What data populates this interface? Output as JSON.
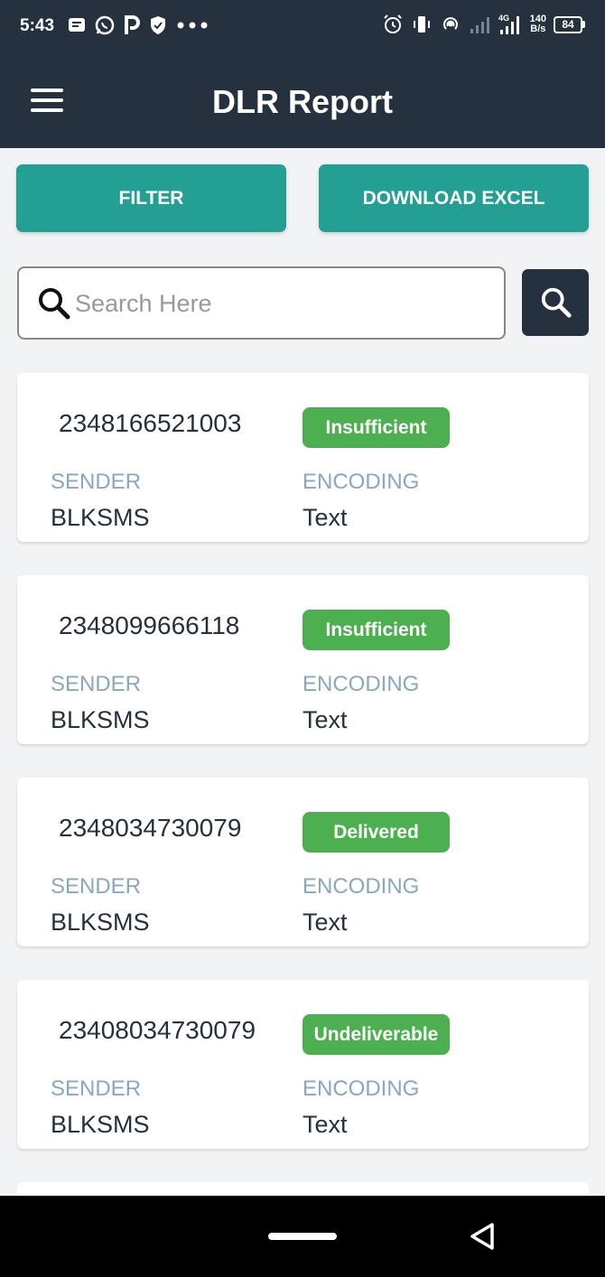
{
  "status_bar": {
    "time": "5:43",
    "net_speed_value": "140",
    "net_speed_unit": "B/s",
    "network_type": "4G",
    "battery": "84",
    "left_icons": [
      "message-icon",
      "whatsapp-icon",
      "p-app-icon",
      "shield-icon",
      "more-dots-icon"
    ],
    "right_icons": [
      "alarm-icon",
      "vibrate-icon",
      "hotspot-icon",
      "signal-icon",
      "signal-4g-icon"
    ]
  },
  "header": {
    "title": "DLR Report"
  },
  "actions": {
    "filter_label": "FILTER",
    "download_label": "DOWNLOAD EXCEL"
  },
  "search": {
    "placeholder": "Search Here",
    "value": ""
  },
  "colors": {
    "header_bg": "#25313f",
    "accent": "#23a093",
    "status_green": "#4caf50",
    "label_blue": "#8aa7c2"
  },
  "reports": [
    {
      "number": "2348166521003",
      "status": "Insufficient",
      "sender_label": "SENDER",
      "sender": "BLKSMS",
      "encoding_label": "ENCODING",
      "encoding": "Text"
    },
    {
      "number": "2348099666118",
      "status": "Insufficient",
      "sender_label": "SENDER",
      "sender": "BLKSMS",
      "encoding_label": "ENCODING",
      "encoding": "Text"
    },
    {
      "number": "2348034730079",
      "status": "Delivered",
      "sender_label": "SENDER",
      "sender": "BLKSMS",
      "encoding_label": "ENCODING",
      "encoding": "Text"
    },
    {
      "number": "23408034730079",
      "status": "Undeliverable",
      "sender_label": "SENDER",
      "sender": "BLKSMS",
      "encoding_label": "ENCODING",
      "encoding": "Text"
    }
  ]
}
